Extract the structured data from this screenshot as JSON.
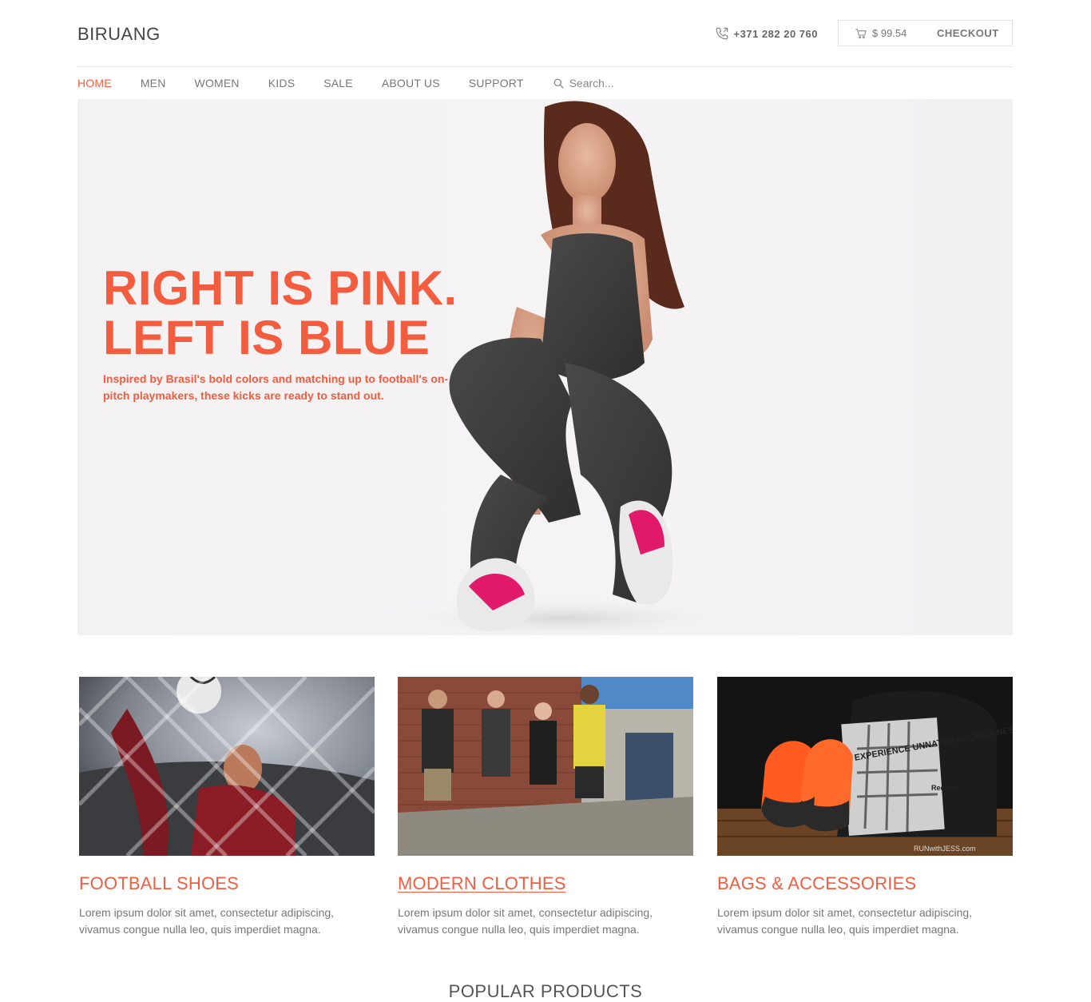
{
  "header": {
    "logo": "BIRUANG",
    "phone": "+371 282 20 760",
    "cart_total": "$ 99.54",
    "checkout": "CHECKOUT"
  },
  "nav": {
    "items": [
      {
        "label": "HOME",
        "active": true
      },
      {
        "label": "MEN"
      },
      {
        "label": "WOMEN"
      },
      {
        "label": "KIDS"
      },
      {
        "label": "SALE"
      },
      {
        "label": "ABOUT US"
      },
      {
        "label": "SUPPORT"
      }
    ],
    "search_placeholder": "Search..."
  },
  "hero": {
    "title_line1": "RIGHT IS PINK.",
    "title_line2": "LEFT IS BLUE",
    "text": "Inspired by Brasil's bold colors and matching up to football's on-pitch playmakers, these kicks are ready to stand out."
  },
  "categories": [
    {
      "title": "FOOTBALL SHOES",
      "text": "Lorem ipsum dolor sit amet, consectetur adipiscing, vivamus congue nulla leo, quis imperdiet magna."
    },
    {
      "title": "MODERN CLOTHES",
      "text": "Lorem ipsum dolor sit amet, consectetur adipiscing, vivamus congue nulla leo, quis imperdiet magna."
    },
    {
      "title": "BAGS & ACCESSORIES",
      "text": "Lorem ipsum dolor sit amet, consectetur adipiscing, vivamus congue nulla leo, quis imperdiet magna."
    }
  ],
  "image_text": {
    "bag_slogan": "EXPERIENCE UNNATURAL QUICKNESS.",
    "bag_brand": "Reebok",
    "watermark": "RUNwithJESS.com"
  },
  "section": {
    "popular": "POPULAR PRODUCTS"
  },
  "colors": {
    "accent": "#f25c3f",
    "text": "#777777"
  }
}
